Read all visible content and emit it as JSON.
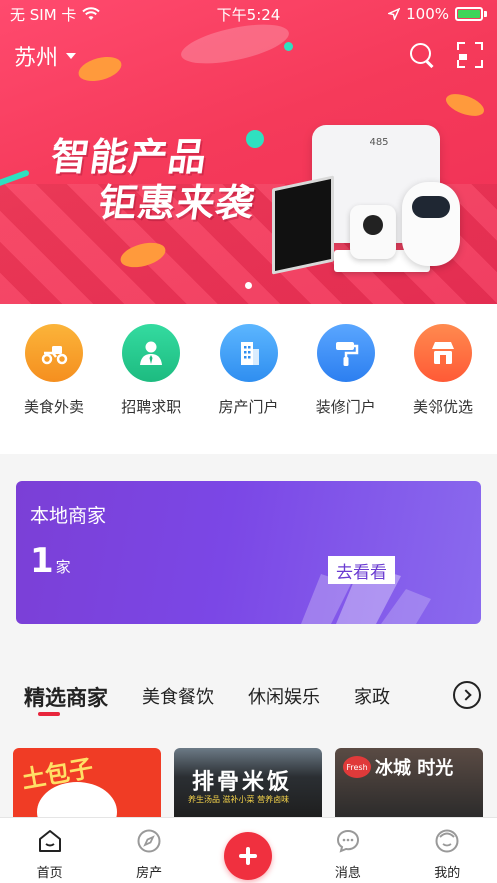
{
  "status_bar": {
    "carrier": "无 SIM 卡",
    "time": "下午5:24",
    "battery": "100%",
    "battery_level": 1.0
  },
  "header": {
    "city": "苏州",
    "icons": [
      "search-icon",
      "scan-icon"
    ]
  },
  "banner": {
    "title_line1": "智能产品",
    "title_line2": "钜惠来袭",
    "scale_display": "485",
    "slide_count_visible": 1
  },
  "categories": [
    {
      "label": "美食外卖",
      "icon": "scooter-icon",
      "color": "#f7a429"
    },
    {
      "label": "招聘求职",
      "icon": "recruit-person-icon",
      "color": "#27c98f"
    },
    {
      "label": "房产门户",
      "icon": "building-icon",
      "color": "#3b9cf3"
    },
    {
      "label": "装修门户",
      "icon": "paint-roller-icon",
      "color": "#3b8ef3"
    },
    {
      "label": "美邻优选",
      "icon": "shop-icon",
      "color": "#ff6a3d"
    }
  ],
  "local_merchants": {
    "title": "本地商家",
    "count": "1",
    "unit": "家",
    "button": "去看看"
  },
  "merchant_tabs": {
    "items": [
      "精选商家",
      "美食餐饮",
      "休闲娱乐",
      "家政"
    ],
    "active_index": 0,
    "more_icon": "chevron-right-icon",
    "accent": "#e8253c"
  },
  "merchant_cards": [
    {
      "sign": "土包子"
    },
    {
      "sign": "排骨米饭",
      "sub": "养生汤品 滋补小菜 营养卤味"
    },
    {
      "badge": "Fresh",
      "sign": "冰城 时光"
    }
  ],
  "bottom_nav": {
    "items": [
      {
        "label": "首页",
        "icon": "home-icon"
      },
      {
        "label": "房产",
        "icon": "compass-icon"
      },
      {
        "label": "",
        "icon": "plus-icon"
      },
      {
        "label": "消息",
        "icon": "message-icon"
      },
      {
        "label": "我的",
        "icon": "user-icon"
      }
    ],
    "add_color": "#f0303f"
  }
}
